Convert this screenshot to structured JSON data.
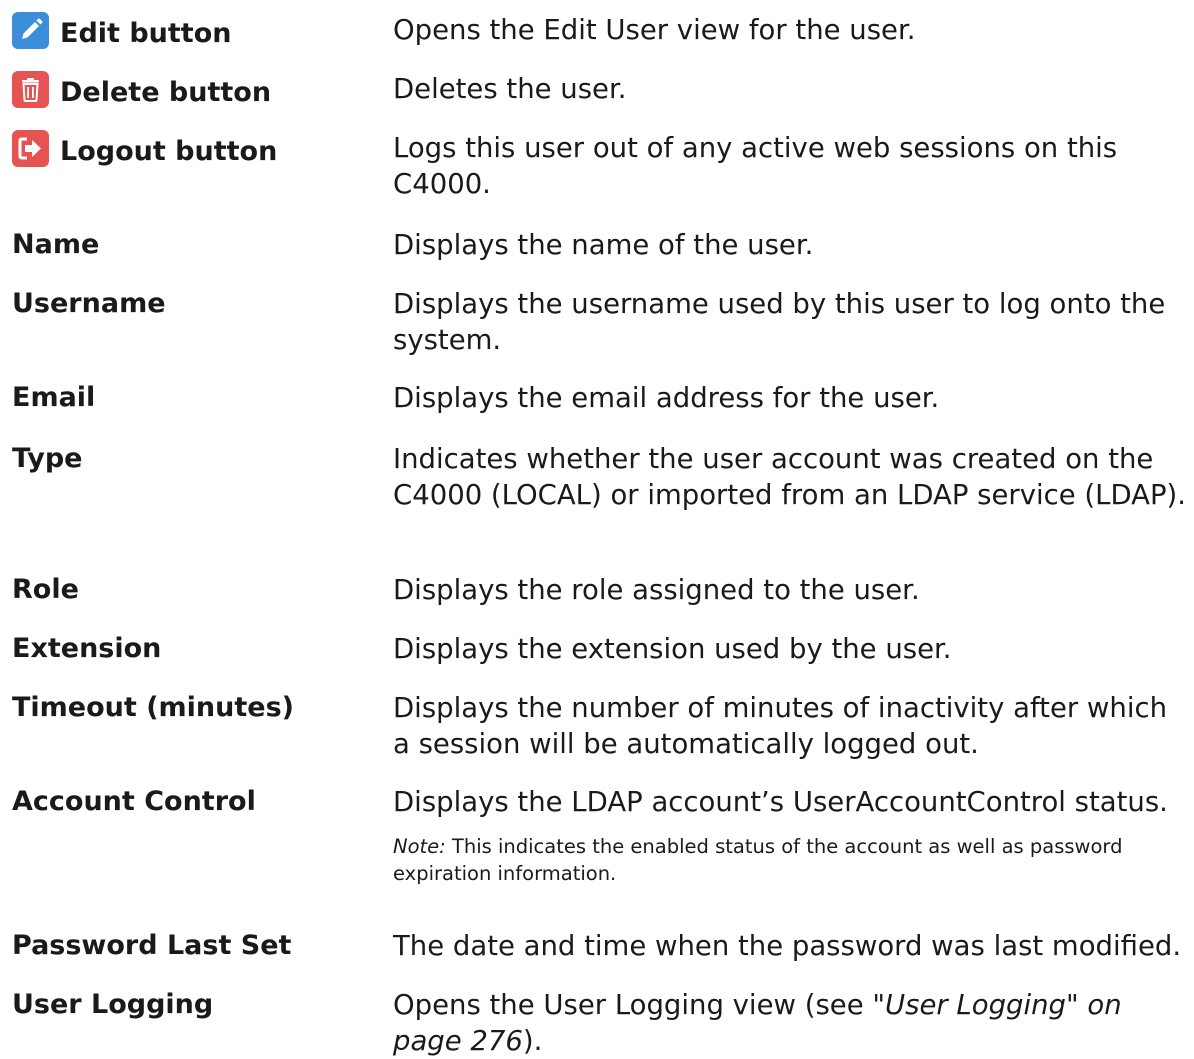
{
  "rows": [
    {
      "term": "Edit button",
      "desc": "Opens the Edit User view for the user."
    },
    {
      "term": "Delete button",
      "desc": "Deletes the user."
    },
    {
      "term": "Logout button",
      "desc": "Logs this user out of any active web sessions on this C4000."
    },
    {
      "term": "Name",
      "desc": "Displays the name of the user."
    },
    {
      "term": "Username",
      "desc": "Displays the username used by this user to log onto the system."
    },
    {
      "term": "Email",
      "desc": "Displays the email address for the user."
    },
    {
      "term": "Type",
      "desc": "Indicates whether the user account was created on the C4000 (LOCAL) or imported from an LDAP service (LDAP)."
    },
    {
      "term": "Role",
      "desc": "Displays the role assigned to the user."
    },
    {
      "term": "Extension",
      "desc": "Displays the extension used by the user."
    },
    {
      "term": "Timeout (minutes)",
      "desc": "Displays the number of minutes of inactivity after which a session will be automatically logged out."
    },
    {
      "term": "Account Control",
      "desc": "Displays the LDAP account’s UserAccountControl status."
    },
    {
      "term": "Password Last Set",
      "desc": "The date and time when the password was last modified."
    },
    {
      "term": "User Logging",
      "desc_before": "Opens the User Logging view (see ",
      "desc_xref": "\"User Logging\" on page 276",
      "desc_after": ")."
    }
  ],
  "note": {
    "label": "Note:",
    "text": " This indicates the enabled status of the account as well as password expiration information."
  },
  "icons": {
    "edit": {
      "name": "pencil-icon",
      "color": "#3b8ed9"
    },
    "delete": {
      "name": "trash-icon",
      "color": "#e65353"
    },
    "logout": {
      "name": "logout-arrow-icon",
      "color": "#e65353"
    }
  }
}
